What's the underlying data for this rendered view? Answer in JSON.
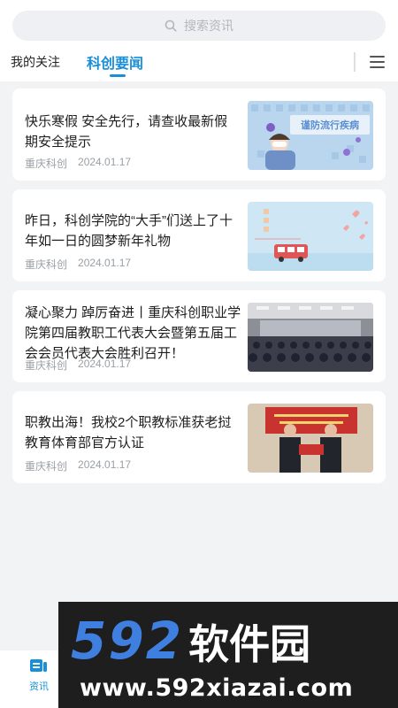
{
  "search": {
    "placeholder": "搜索资讯"
  },
  "tabs": [
    {
      "label": "我的关注"
    },
    {
      "label": "科创要闻"
    }
  ],
  "articles": [
    {
      "title": "快乐寒假 安全先行，请查收最新假期安全提示",
      "source": "重庆科创",
      "date": "2024.01.17",
      "thumb_text": "谨防流行疾病"
    },
    {
      "title": "昨日，科创学院的“大手”们送上了十年如一日的圆梦新年礼物",
      "source": "重庆科创",
      "date": "2024.01.17"
    },
    {
      "title": "凝心聚力 踔厉奋进丨重庆科创职业学院第四届教职工代表大会暨第五届工会会员代表大会胜利召开！",
      "source": "重庆科创",
      "date": "2024.01.17"
    },
    {
      "title": "职教出海！我校2个职教标准获老挝教育体育部官方认证",
      "source": "重庆科创",
      "date": "2024.01.17"
    }
  ],
  "bottom_nav": [
    {
      "label": "资讯"
    }
  ],
  "watermark": {
    "brand_digits": "592",
    "brand_cn": "软件园",
    "url": "www.592xiazai.com"
  },
  "colors": {
    "accent": "#1a8fd8",
    "background": "#f2f3f5"
  }
}
